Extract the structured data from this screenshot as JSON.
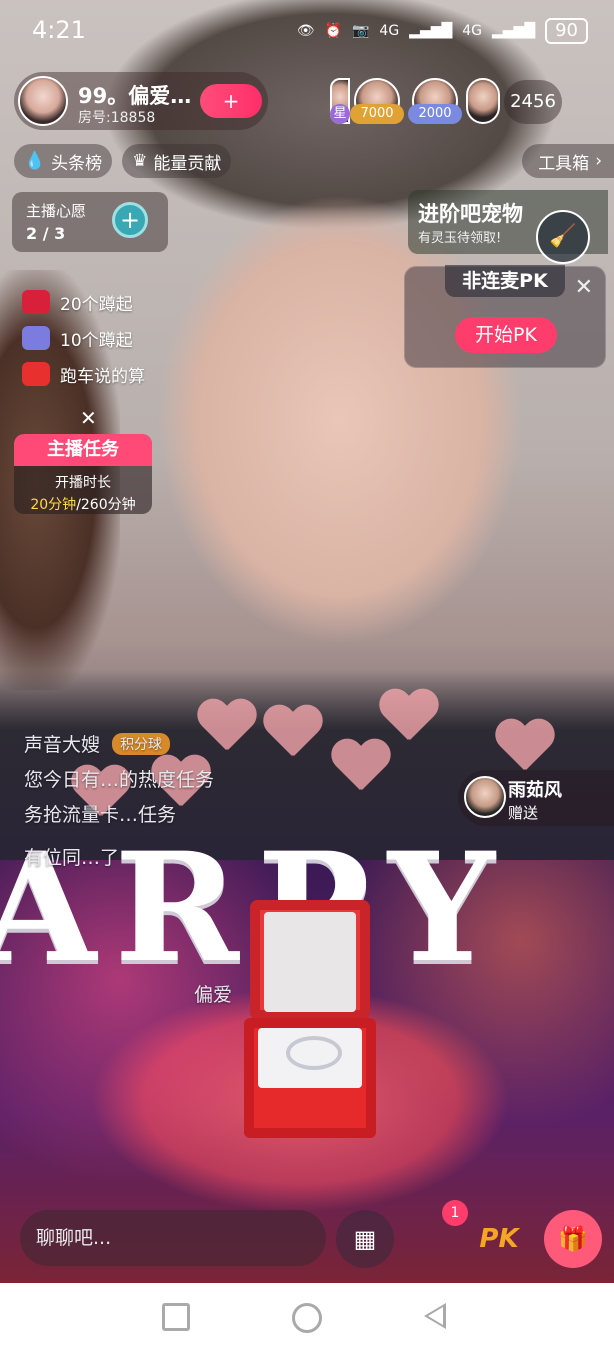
{
  "status_bar": {
    "time": "4:21",
    "net1": "4G",
    "net2": "4G",
    "battery": "90"
  },
  "host": {
    "name": "99。偏爱…",
    "room": "房号:18858",
    "follow_label": "+"
  },
  "viewers": {
    "badges": [
      "星",
      "7000",
      "2000"
    ],
    "count": "2456"
  },
  "ranks": {
    "headlines": "头条榜",
    "energy": "能量贡献",
    "toolbox": "工具箱"
  },
  "wish": {
    "title": "主播心愿",
    "count": "2 / 3"
  },
  "pet": {
    "title": "进阶吧宠物",
    "subtitle": "有灵玉待领取!"
  },
  "pk": {
    "tab": "非连麦PK",
    "start": "开始PK"
  },
  "goals": [
    {
      "label": "20个蹲起",
      "color": "#d8203a"
    },
    {
      "label": "10个蹲起",
      "color": "#7c7ce0"
    },
    {
      "label": "跑车说的算",
      "color": "#e8302e"
    }
  ],
  "task": {
    "title": "主播任务",
    "line1": "开播时长",
    "progress": "20分钟",
    "total": "/260分钟"
  },
  "chat": {
    "user": "声音大嫂",
    "badge": "积分球",
    "line1": "您今日有…的热度任务",
    "line2": "务抢流量卡…任务",
    "line3": "有位同…了",
    "line4": "偏爱"
  },
  "gift_toast": {
    "name": "雨茹风",
    "action": "赠送"
  },
  "scene": {
    "big_text": "ARPY"
  },
  "bottom": {
    "chat_placeholder": "聊聊吧...",
    "notification_count": "1",
    "pk_label": "PK"
  }
}
